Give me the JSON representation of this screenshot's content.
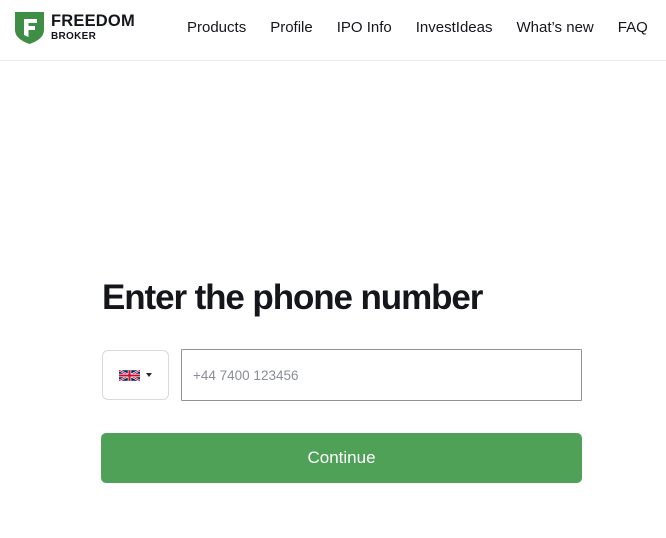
{
  "brand": {
    "name_line1": "FREEDOM",
    "name_line2": "BROKER",
    "colors": {
      "green": "#4ea157",
      "logo_green": "#3e8e46",
      "text": "#14161c"
    }
  },
  "nav": {
    "items": [
      {
        "label": "Products"
      },
      {
        "label": "Profile"
      },
      {
        "label": "IPO Info"
      },
      {
        "label": "InvestIdeas"
      },
      {
        "label": "What’s new"
      },
      {
        "label": "FAQ"
      }
    ]
  },
  "main": {
    "title": "Enter the phone number",
    "country_select": {
      "flag_icon": "uk-flag-icon",
      "caret_icon": "caret-down-icon"
    },
    "phone": {
      "placeholder": "+44 7400 123456",
      "value": ""
    },
    "continue_label": "Continue"
  }
}
